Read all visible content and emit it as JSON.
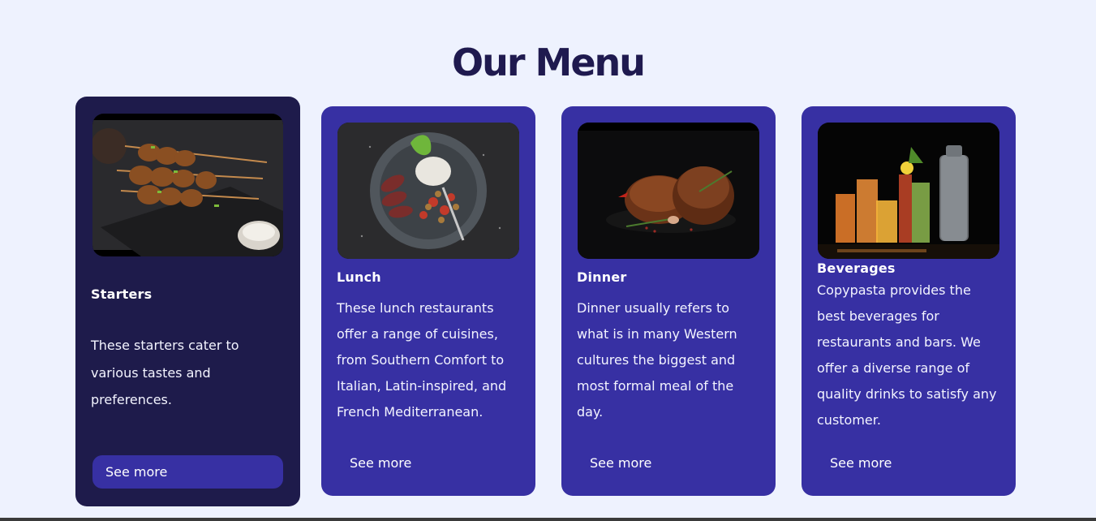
{
  "page": {
    "title": "Our Menu"
  },
  "cards": [
    {
      "title": "Starters",
      "description": "These starters cater to various tastes and preferences.",
      "button_label": "See more",
      "image_subject": "grilled skewers"
    },
    {
      "title": "Lunch",
      "description": "These lunch restaurants offer a range of cuisines, from Southern Comfort to Italian, Latin-inspired, and French Mediterranean.",
      "button_label": "See more",
      "image_subject": "steak plate"
    },
    {
      "title": "Dinner",
      "description": "Dinner usually refers to what is in many Western cultures the biggest and most formal meal of the day.",
      "button_label": "See more",
      "image_subject": "steak"
    },
    {
      "title": "Beverages",
      "description": "Copypasta provides the best beverages for restaurants and bars. We offer a diverse range of quality drinks to satisfy any customer.",
      "button_label": "See more",
      "image_subject": "cocktails and shaker"
    }
  ],
  "colors": {
    "background": "#eef2fe",
    "title": "#1f1a4f",
    "card": "#3730a3",
    "card_featured": "#1e1b4b",
    "text": "#ffffff"
  }
}
